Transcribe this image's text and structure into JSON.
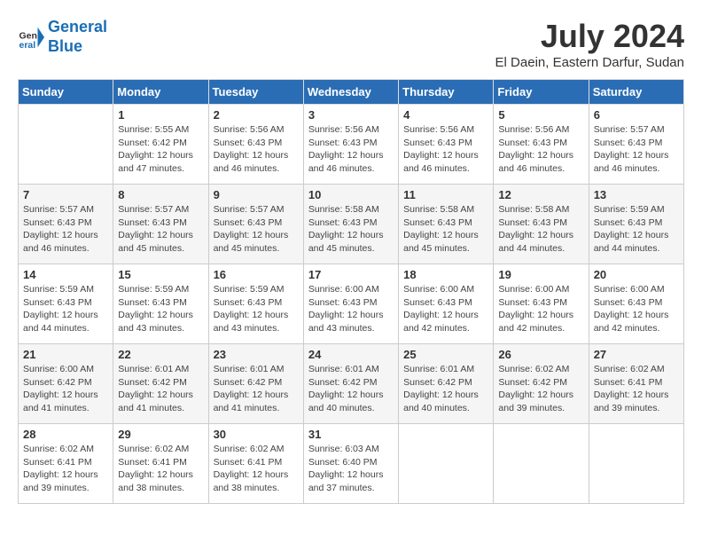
{
  "header": {
    "logo_line1": "General",
    "logo_line2": "Blue",
    "month_title": "July 2024",
    "location": "El Daein, Eastern Darfur, Sudan"
  },
  "columns": [
    "Sunday",
    "Monday",
    "Tuesday",
    "Wednesday",
    "Thursday",
    "Friday",
    "Saturday"
  ],
  "weeks": [
    [
      {
        "day": "",
        "info": ""
      },
      {
        "day": "1",
        "info": "Sunrise: 5:55 AM\nSunset: 6:42 PM\nDaylight: 12 hours\nand 47 minutes."
      },
      {
        "day": "2",
        "info": "Sunrise: 5:56 AM\nSunset: 6:43 PM\nDaylight: 12 hours\nand 46 minutes."
      },
      {
        "day": "3",
        "info": "Sunrise: 5:56 AM\nSunset: 6:43 PM\nDaylight: 12 hours\nand 46 minutes."
      },
      {
        "day": "4",
        "info": "Sunrise: 5:56 AM\nSunset: 6:43 PM\nDaylight: 12 hours\nand 46 minutes."
      },
      {
        "day": "5",
        "info": "Sunrise: 5:56 AM\nSunset: 6:43 PM\nDaylight: 12 hours\nand 46 minutes."
      },
      {
        "day": "6",
        "info": "Sunrise: 5:57 AM\nSunset: 6:43 PM\nDaylight: 12 hours\nand 46 minutes."
      }
    ],
    [
      {
        "day": "7",
        "info": "Sunrise: 5:57 AM\nSunset: 6:43 PM\nDaylight: 12 hours\nand 46 minutes."
      },
      {
        "day": "8",
        "info": "Sunrise: 5:57 AM\nSunset: 6:43 PM\nDaylight: 12 hours\nand 45 minutes."
      },
      {
        "day": "9",
        "info": "Sunrise: 5:57 AM\nSunset: 6:43 PM\nDaylight: 12 hours\nand 45 minutes."
      },
      {
        "day": "10",
        "info": "Sunrise: 5:58 AM\nSunset: 6:43 PM\nDaylight: 12 hours\nand 45 minutes."
      },
      {
        "day": "11",
        "info": "Sunrise: 5:58 AM\nSunset: 6:43 PM\nDaylight: 12 hours\nand 45 minutes."
      },
      {
        "day": "12",
        "info": "Sunrise: 5:58 AM\nSunset: 6:43 PM\nDaylight: 12 hours\nand 44 minutes."
      },
      {
        "day": "13",
        "info": "Sunrise: 5:59 AM\nSunset: 6:43 PM\nDaylight: 12 hours\nand 44 minutes."
      }
    ],
    [
      {
        "day": "14",
        "info": "Sunrise: 5:59 AM\nSunset: 6:43 PM\nDaylight: 12 hours\nand 44 minutes."
      },
      {
        "day": "15",
        "info": "Sunrise: 5:59 AM\nSunset: 6:43 PM\nDaylight: 12 hours\nand 43 minutes."
      },
      {
        "day": "16",
        "info": "Sunrise: 5:59 AM\nSunset: 6:43 PM\nDaylight: 12 hours\nand 43 minutes."
      },
      {
        "day": "17",
        "info": "Sunrise: 6:00 AM\nSunset: 6:43 PM\nDaylight: 12 hours\nand 43 minutes."
      },
      {
        "day": "18",
        "info": "Sunrise: 6:00 AM\nSunset: 6:43 PM\nDaylight: 12 hours\nand 42 minutes."
      },
      {
        "day": "19",
        "info": "Sunrise: 6:00 AM\nSunset: 6:43 PM\nDaylight: 12 hours\nand 42 minutes."
      },
      {
        "day": "20",
        "info": "Sunrise: 6:00 AM\nSunset: 6:43 PM\nDaylight: 12 hours\nand 42 minutes."
      }
    ],
    [
      {
        "day": "21",
        "info": "Sunrise: 6:00 AM\nSunset: 6:42 PM\nDaylight: 12 hours\nand 41 minutes."
      },
      {
        "day": "22",
        "info": "Sunrise: 6:01 AM\nSunset: 6:42 PM\nDaylight: 12 hours\nand 41 minutes."
      },
      {
        "day": "23",
        "info": "Sunrise: 6:01 AM\nSunset: 6:42 PM\nDaylight: 12 hours\nand 41 minutes."
      },
      {
        "day": "24",
        "info": "Sunrise: 6:01 AM\nSunset: 6:42 PM\nDaylight: 12 hours\nand 40 minutes."
      },
      {
        "day": "25",
        "info": "Sunrise: 6:01 AM\nSunset: 6:42 PM\nDaylight: 12 hours\nand 40 minutes."
      },
      {
        "day": "26",
        "info": "Sunrise: 6:02 AM\nSunset: 6:42 PM\nDaylight: 12 hours\nand 39 minutes."
      },
      {
        "day": "27",
        "info": "Sunrise: 6:02 AM\nSunset: 6:41 PM\nDaylight: 12 hours\nand 39 minutes."
      }
    ],
    [
      {
        "day": "28",
        "info": "Sunrise: 6:02 AM\nSunset: 6:41 PM\nDaylight: 12 hours\nand 39 minutes."
      },
      {
        "day": "29",
        "info": "Sunrise: 6:02 AM\nSunset: 6:41 PM\nDaylight: 12 hours\nand 38 minutes."
      },
      {
        "day": "30",
        "info": "Sunrise: 6:02 AM\nSunset: 6:41 PM\nDaylight: 12 hours\nand 38 minutes."
      },
      {
        "day": "31",
        "info": "Sunrise: 6:03 AM\nSunset: 6:40 PM\nDaylight: 12 hours\nand 37 minutes."
      },
      {
        "day": "",
        "info": ""
      },
      {
        "day": "",
        "info": ""
      },
      {
        "day": "",
        "info": ""
      }
    ]
  ]
}
